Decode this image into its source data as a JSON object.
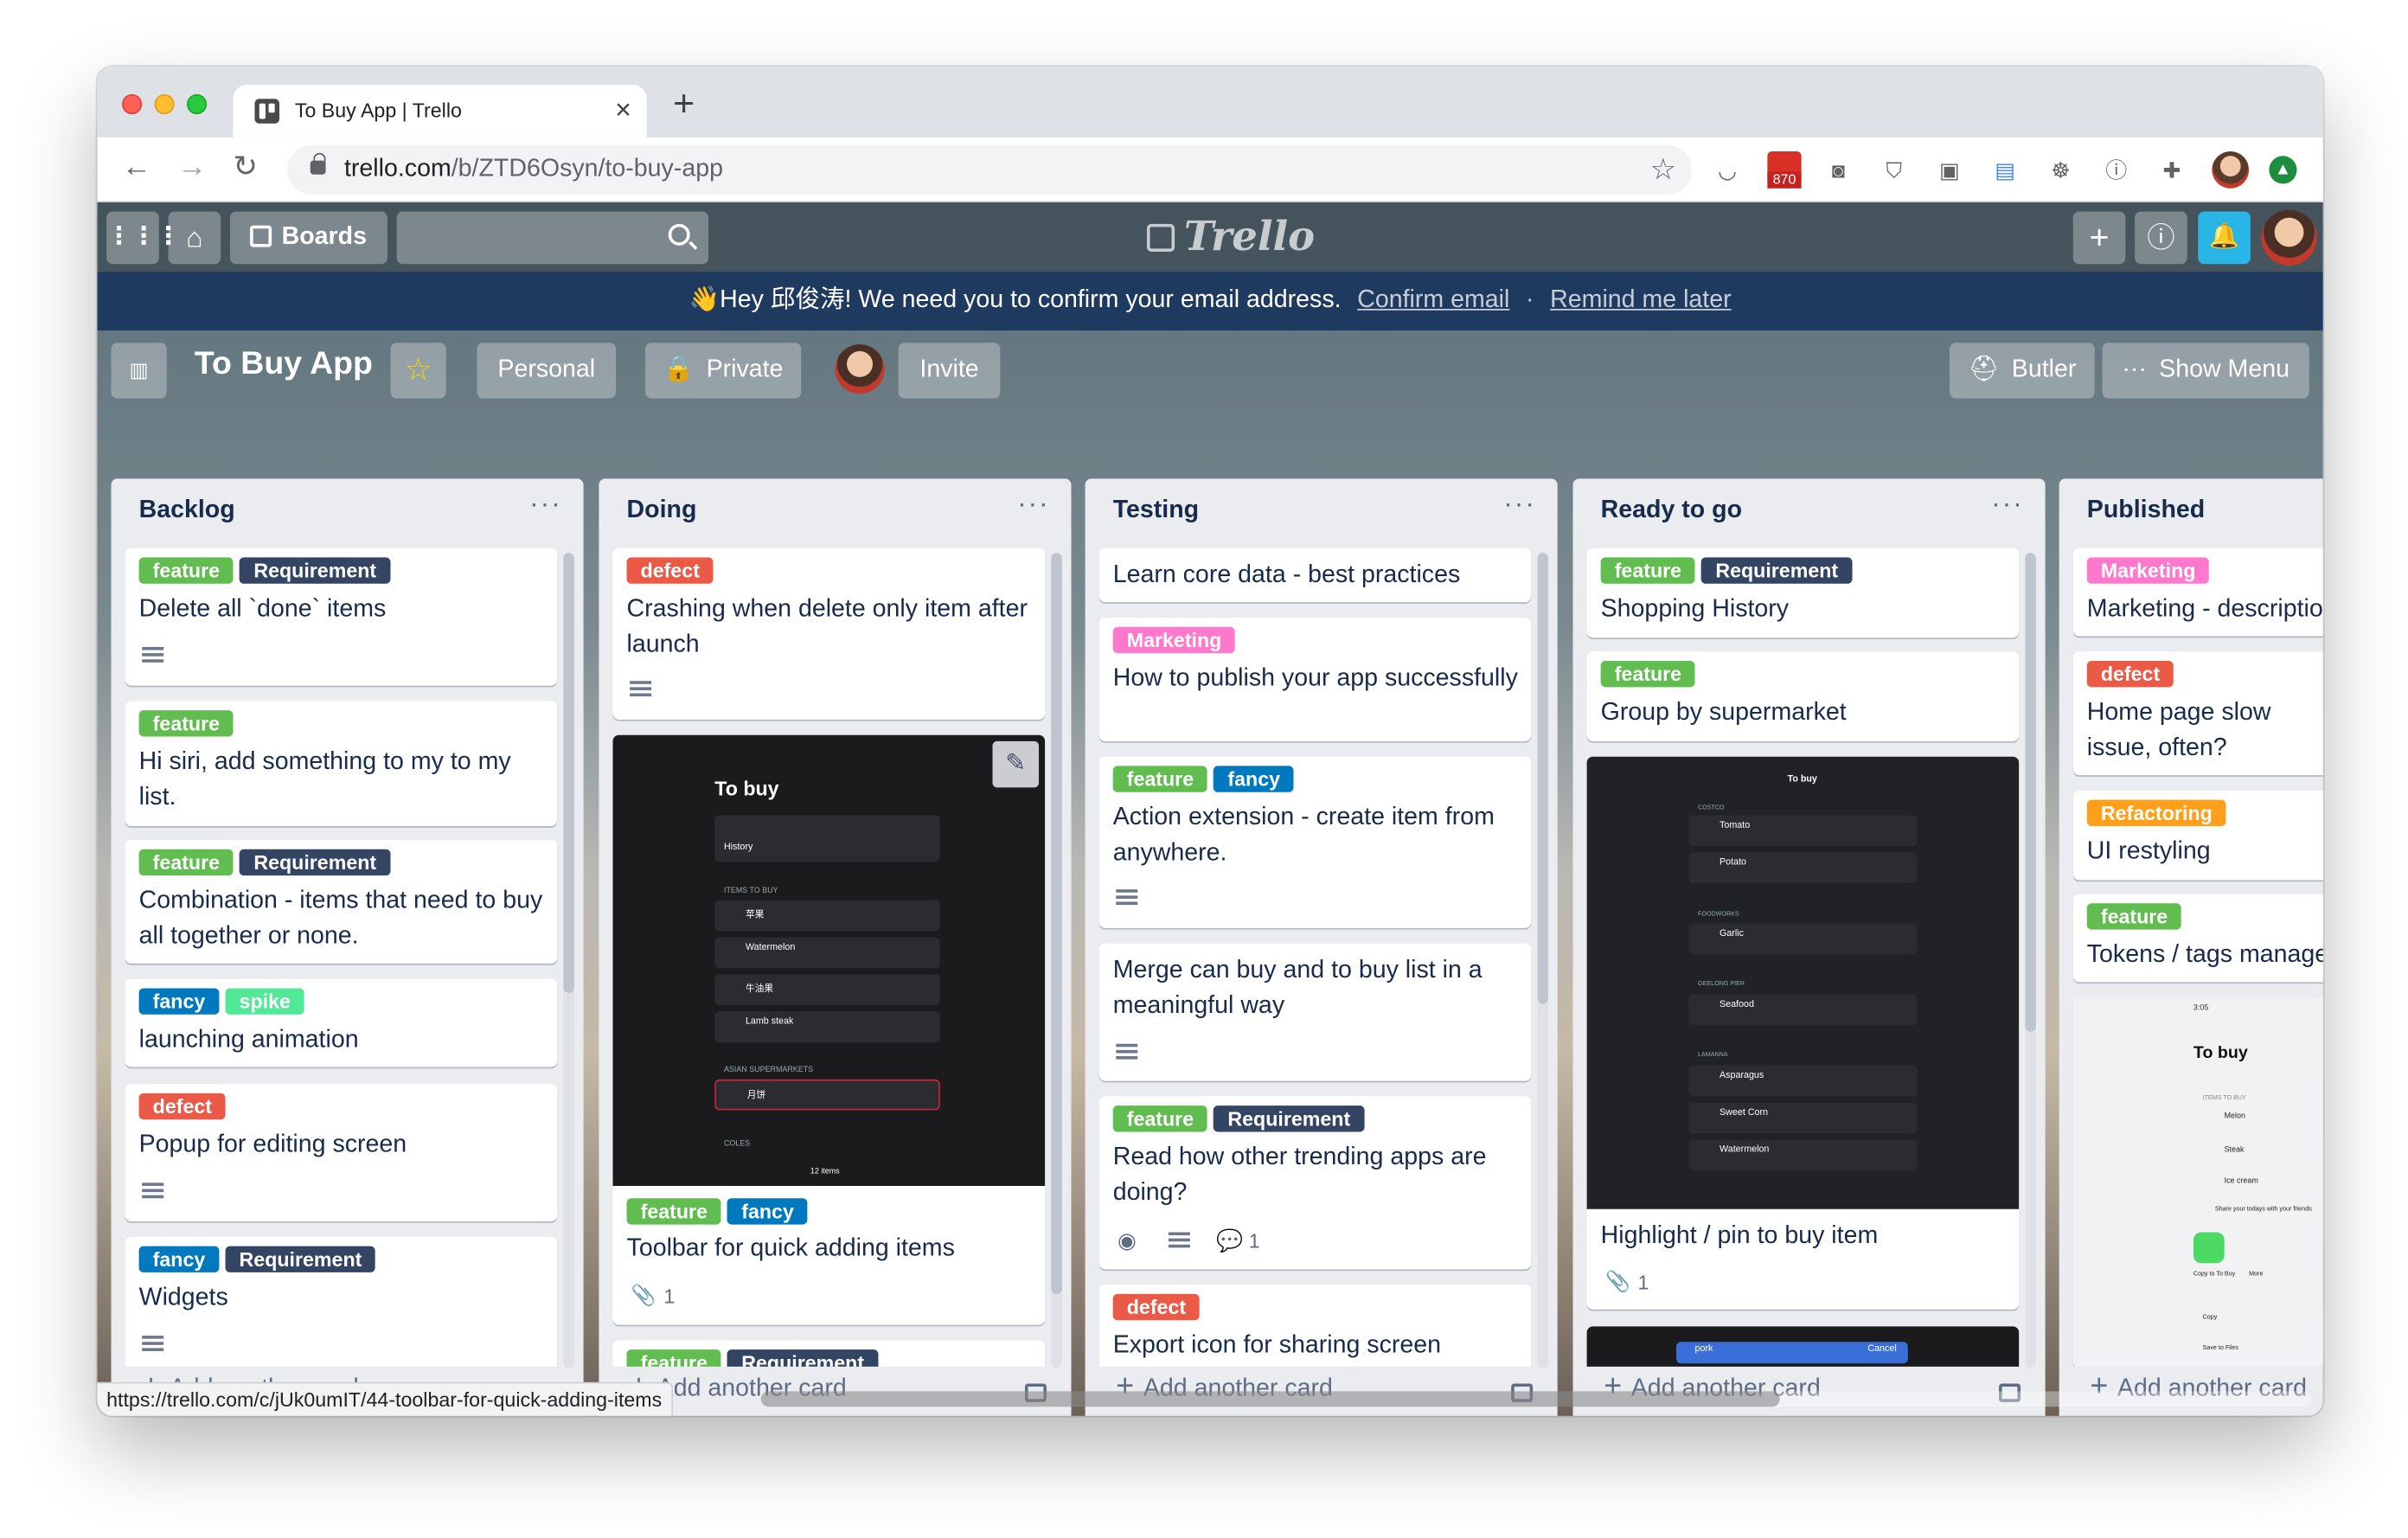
{
  "browser": {
    "tab_title": "To Buy App | Trello",
    "tab_close": "×",
    "new_tab": "+",
    "url_host": "trello.com",
    "url_path": "/b/ZTD6Osyn/to-buy-app",
    "gmail_count": "870",
    "status_url": "https://trello.com/c/jUk0umIT/44-toolbar-for-quick-adding-items"
  },
  "header": {
    "boards_label": "Boards",
    "logo_text": "Trello"
  },
  "banner": {
    "message": "👋Hey 邱俊涛! We need you to confirm your email address.",
    "confirm_link": "Confirm email",
    "separator": "·",
    "remind_link": "Remind me later"
  },
  "board": {
    "title": "To Buy App",
    "visibility_team": "Personal",
    "privacy": "Private",
    "invite": "Invite",
    "butler": "Butler",
    "show_menu": "Show Menu"
  },
  "add_card_label": "Add another card",
  "lists": [
    {
      "title": "Backlog",
      "cards": [
        {
          "labels": [
            {
              "text": "feature",
              "color": "green"
            },
            {
              "text": "Requirement",
              "color": "navy"
            }
          ],
          "title": "Delete all `done` items",
          "desc": true
        },
        {
          "labels": [
            {
              "text": "feature",
              "color": "green"
            }
          ],
          "title": "Hi siri, add something to my to my list."
        },
        {
          "labels": [
            {
              "text": "feature",
              "color": "green"
            },
            {
              "text": "Requirement",
              "color": "navy"
            }
          ],
          "title": "Combination - items that need to buy all together or none."
        },
        {
          "labels": [
            {
              "text": "fancy",
              "color": "blue"
            },
            {
              "text": "spike",
              "color": "lime"
            }
          ],
          "title": "launching animation"
        },
        {
          "labels": [
            {
              "text": "defect",
              "color": "red"
            }
          ],
          "title": "Popup for editing screen",
          "desc": true
        },
        {
          "labels": [
            {
              "text": "fancy",
              "color": "blue"
            },
            {
              "text": "Requirement",
              "color": "navy"
            }
          ],
          "title": "Widgets",
          "desc": true
        }
      ]
    },
    {
      "title": "Doing",
      "cards": [
        {
          "labels": [
            {
              "text": "defect",
              "color": "red"
            }
          ],
          "title": "Crashing when delete only item after launch",
          "desc": true
        },
        {
          "labels": [
            {
              "text": "feature",
              "color": "green"
            },
            {
              "text": "fancy",
              "color": "blue"
            }
          ],
          "title": "Toolbar for quick adding items",
          "attachments": "1",
          "cover": {
            "heading": "To buy",
            "history": "History",
            "section": "ITEMS TO BUY",
            "items": [
              "苹果",
              "Watermelon",
              "牛油果",
              "Lamb steak"
            ],
            "section2": "ASIAN SUPERMARKETS",
            "items2": [
              "月饼"
            ],
            "section3": "COLES",
            "footer": "12 items"
          }
        },
        {
          "labels": [
            {
              "text": "feature",
              "color": "green"
            },
            {
              "text": "Requirement",
              "color": "navy"
            }
          ],
          "title": ""
        }
      ]
    },
    {
      "title": "Testing",
      "cards": [
        {
          "labels": [],
          "title": "Learn core data - best practices"
        },
        {
          "labels": [
            {
              "text": "Marketing",
              "color": "pink"
            }
          ],
          "title": "How to publish your app successfully"
        },
        {
          "labels": [
            {
              "text": "feature",
              "color": "green"
            },
            {
              "text": "fancy",
              "color": "blue"
            }
          ],
          "title": "Action extension - create item from anywhere.",
          "desc": true
        },
        {
          "labels": [],
          "title": "Merge can buy and to buy list in a meaningful way",
          "desc": true
        },
        {
          "labels": [
            {
              "text": "feature",
              "color": "green"
            },
            {
              "text": "Requirement",
              "color": "navy"
            }
          ],
          "title": "Read how other trending apps are doing?",
          "comments": "1"
        },
        {
          "labels": [
            {
              "text": "defect",
              "color": "red"
            }
          ],
          "title": "Export icon for sharing screen"
        }
      ]
    },
    {
      "title": "Ready to go",
      "cards": [
        {
          "labels": [
            {
              "text": "feature",
              "color": "green"
            },
            {
              "text": "Requirement",
              "color": "navy"
            }
          ],
          "title": "Shopping History"
        },
        {
          "labels": [
            {
              "text": "feature",
              "color": "green"
            }
          ],
          "title": "Group by supermarket"
        },
        {
          "labels": [],
          "title": "Highlight / pin to buy item",
          "attachments": "1",
          "cover": {
            "heading": "To buy",
            "section": "COSTCO",
            "items": [
              "Tomato",
              "Potato"
            ],
            "section2": "FOODWORKS",
            "items2": [
              "Garlic"
            ],
            "section3": "GEELONG PIER",
            "items3": [
              "Seafood"
            ],
            "section4": "LAMANNA",
            "items4": [
              "Asparagus",
              "Sweet Corn",
              "Watermelon"
            ]
          }
        },
        {
          "labels": [],
          "title": "",
          "cover": {
            "search": "pork",
            "cancel": "Cancel"
          }
        }
      ]
    },
    {
      "title": "Published",
      "cards": [
        {
          "labels": [
            {
              "text": "Marketing",
              "color": "pink"
            }
          ],
          "title": "Marketing - description"
        },
        {
          "labels": [
            {
              "text": "defect",
              "color": "red"
            }
          ],
          "title": "Home page slow issue, often?"
        },
        {
          "labels": [
            {
              "text": "Refactoring",
              "color": "orange"
            }
          ],
          "title": "UI restyling"
        },
        {
          "labels": [
            {
              "text": "feature",
              "color": "green"
            }
          ],
          "title": "Tokens / tags management"
        },
        {
          "labels": [],
          "title": "",
          "cover": {
            "heading": "To buy",
            "time": "3:05",
            "section": "ITEMS TO BUY",
            "items": [
              "Melon",
              "Steak",
              "Ice cream"
            ],
            "share": "Share your todays with your friends",
            "copy_to": "Copy to To Buy",
            "more": "More",
            "copy": "Copy",
            "save": "Save to Files"
          }
        }
      ]
    }
  ]
}
